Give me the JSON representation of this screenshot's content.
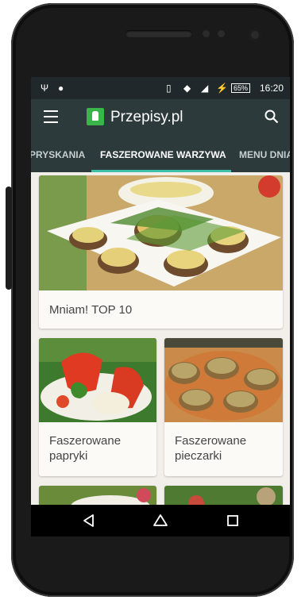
{
  "status_bar": {
    "time": "16:20",
    "battery": "65%"
  },
  "app_bar": {
    "title": "Przepisy.pl"
  },
  "tabs": [
    "PRYSKANIA",
    "FASZEROWANE WARZYWA",
    "MENU DNIA"
  ],
  "cards": {
    "featured": "Mniam! TOP 10",
    "left": "Faszerowane papryki",
    "right": "Faszerowane pieczarki"
  },
  "colors": {
    "app_bar": "#2c3a3c",
    "tab_indicator": "#3fbfa8",
    "logo": "#39b54a"
  }
}
